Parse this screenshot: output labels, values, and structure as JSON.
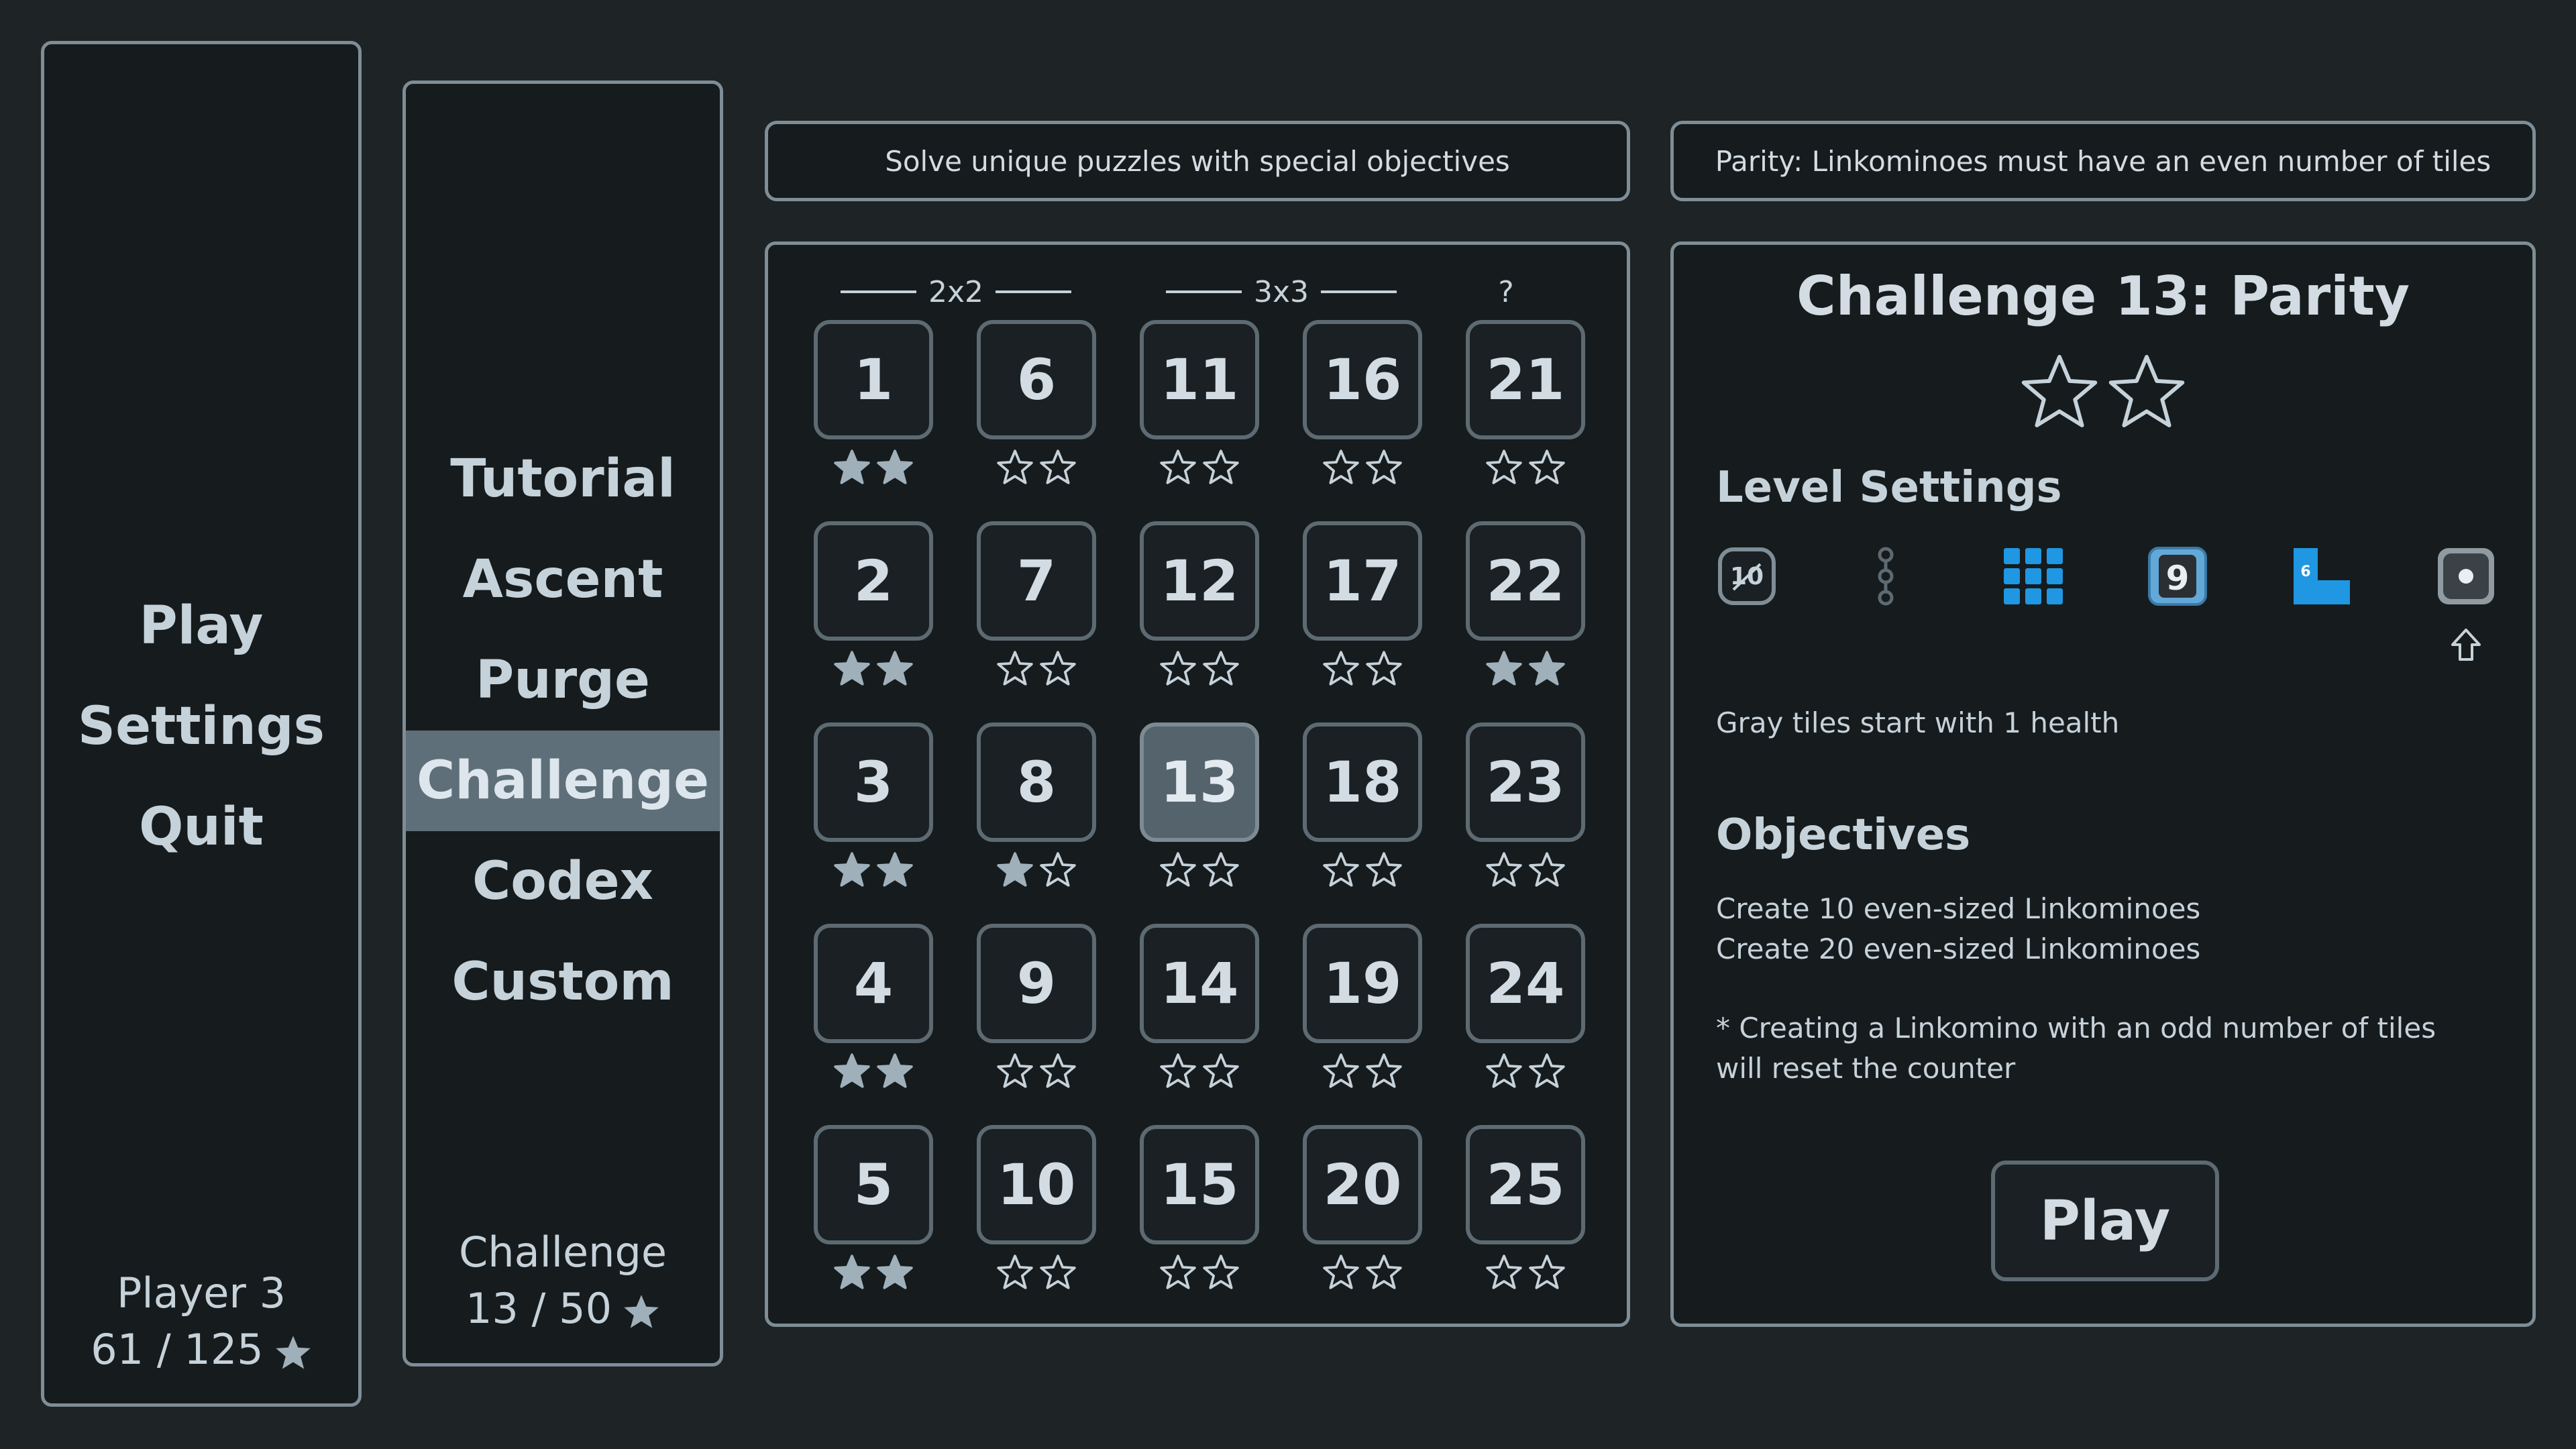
{
  "main_menu": {
    "items": [
      {
        "label": "Play",
        "selected": true
      },
      {
        "label": "Settings",
        "selected": false
      },
      {
        "label": "Quit",
        "selected": false
      }
    ],
    "player_name": "Player 3",
    "player_stars": "61 / 125"
  },
  "mode_menu": {
    "items": [
      {
        "label": "Tutorial",
        "selected": false
      },
      {
        "label": "Ascent",
        "selected": false
      },
      {
        "label": "Purge",
        "selected": false
      },
      {
        "label": "Challenge",
        "selected": true
      },
      {
        "label": "Codex",
        "selected": false
      },
      {
        "label": "Custom",
        "selected": false
      }
    ],
    "footer_title": "Challenge",
    "footer_stars": "13 / 50"
  },
  "description": "Solve unique puzzles with special objectives",
  "hint": "Parity: Linkominoes must have an even number of tiles",
  "grid": {
    "groups": [
      "2x2",
      "3x3",
      "?"
    ],
    "levels": [
      {
        "n": "1",
        "stars": 2
      },
      {
        "n": "6",
        "stars": 0
      },
      {
        "n": "11",
        "stars": 0
      },
      {
        "n": "16",
        "stars": 0
      },
      {
        "n": "21",
        "stars": 0
      },
      {
        "n": "2",
        "stars": 2
      },
      {
        "n": "7",
        "stars": 0
      },
      {
        "n": "12",
        "stars": 0
      },
      {
        "n": "17",
        "stars": 0
      },
      {
        "n": "22",
        "stars": 2
      },
      {
        "n": "3",
        "stars": 2
      },
      {
        "n": "8",
        "stars": 1
      },
      {
        "n": "13",
        "stars": 0,
        "selected": true
      },
      {
        "n": "18",
        "stars": 0
      },
      {
        "n": "23",
        "stars": 0
      },
      {
        "n": "4",
        "stars": 2
      },
      {
        "n": "9",
        "stars": 0
      },
      {
        "n": "14",
        "stars": 0
      },
      {
        "n": "19",
        "stars": 0
      },
      {
        "n": "24",
        "stars": 0
      },
      {
        "n": "5",
        "stars": 2
      },
      {
        "n": "10",
        "stars": 0
      },
      {
        "n": "15",
        "stars": 0
      },
      {
        "n": "20",
        "stars": 0
      },
      {
        "n": "25",
        "stars": 0
      }
    ]
  },
  "detail": {
    "title": "Challenge 13: Parity",
    "stars_earned": 0,
    "stars_total": 2,
    "level_settings_heading": "Level Settings",
    "settings_icons": {
      "timer_label": "10",
      "number_tile_label": "9",
      "shape_label": "6"
    },
    "settings_note": "Gray tiles start with 1 health",
    "objectives_heading": "Objectives",
    "objectives": [
      "Create 10 even-sized Linkominoes",
      "Create 20 even-sized Linkominoes"
    ],
    "footnote": "* Creating a Linkomino with an odd number of tiles will reset the counter",
    "play_label": "Play"
  },
  "colors": {
    "star_filled": "#9fb0bb",
    "star_outline": "#c6d2da",
    "accent_blue": "#1f97e2"
  }
}
